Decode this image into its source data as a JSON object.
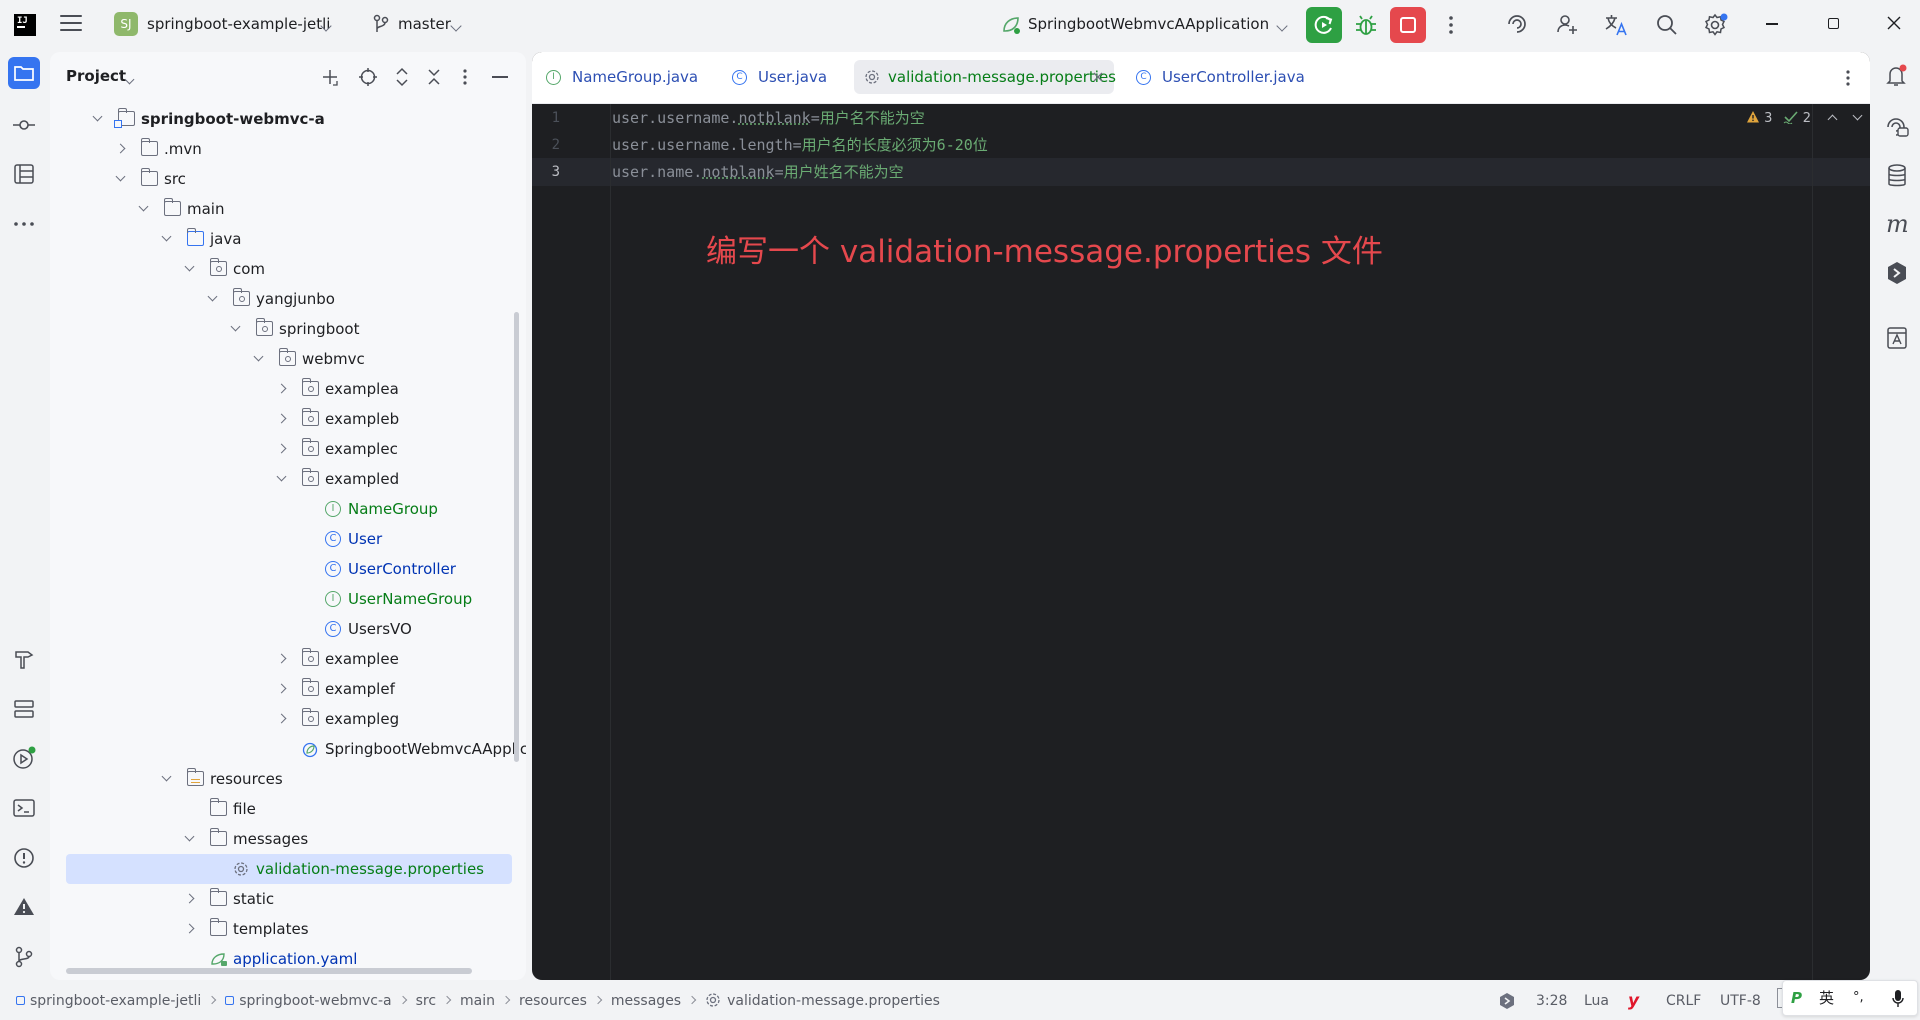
{
  "topbar": {
    "project_badge": "SJ",
    "project_name": "springboot-example-jetli",
    "branch": "master",
    "run_config": "SpringbootWebmvcAApplication"
  },
  "project_panel": {
    "title": "Project",
    "tree": [
      {
        "label": "springboot-webmvc-a",
        "bold": true
      },
      {
        "label": ".mvn"
      },
      {
        "label": "src"
      },
      {
        "label": "main"
      },
      {
        "label": "java"
      },
      {
        "label": "com"
      },
      {
        "label": "yangjunbo"
      },
      {
        "label": "springboot"
      },
      {
        "label": "webmvc"
      },
      {
        "label": "examplea"
      },
      {
        "label": "exampleb"
      },
      {
        "label": "examplec"
      },
      {
        "label": "exampled"
      },
      {
        "label": "NameGroup",
        "kind": "interface"
      },
      {
        "label": "User",
        "kind": "class"
      },
      {
        "label": "UserController",
        "kind": "class"
      },
      {
        "label": "UserNameGroup",
        "kind": "interface"
      },
      {
        "label": "UsersVO",
        "kind": "class"
      },
      {
        "label": "examplee"
      },
      {
        "label": "examplef"
      },
      {
        "label": "exampleg"
      },
      {
        "label": "SpringbootWebmvcAApplicat"
      },
      {
        "label": "resources"
      },
      {
        "label": "file"
      },
      {
        "label": "messages"
      },
      {
        "label": "validation-message.properties",
        "selected": true
      },
      {
        "label": "static"
      },
      {
        "label": "templates"
      },
      {
        "label": "application.yaml"
      }
    ],
    "icon_badges": {
      "interface": "I",
      "class": "C"
    }
  },
  "editor": {
    "tabs": [
      {
        "label": "NameGroup.java"
      },
      {
        "label": "User.java"
      },
      {
        "label": "validation-message.properties",
        "active": true
      },
      {
        "label": "UserController.java"
      }
    ],
    "lines": [
      {
        "num": "1",
        "key_a": "user.username.",
        "key_b": "notblank",
        "eq": "=",
        "value": "用户名不能为空"
      },
      {
        "num": "2",
        "key_a": "user.username.length",
        "key_b": "",
        "eq": "=",
        "value": "用户名的长度必须为6-20位"
      },
      {
        "num": "3",
        "key_a": "user.name.",
        "key_b": "notblank",
        "eq": "=",
        "value": "用户姓名不能为空"
      }
    ],
    "warnings": "3",
    "checks": "2",
    "annotation": "编写一个 validation-message.properties 文件"
  },
  "statusbar": {
    "crumbs": [
      "springboot-example-jetli",
      "springboot-webmvc-a",
      "src",
      "main",
      "resources",
      "messages",
      "validation-message.properties"
    ],
    "position": "3:28",
    "language": "Lua",
    "line_sep": "CRLF",
    "encoding": "UTF-8",
    "ime_lang": "英",
    "ime_punct": "°,"
  },
  "colors": {
    "accent": "#3574f0",
    "run_green": "#2ea043",
    "stop_red": "#e5484d",
    "annotation_red": "#e5484d"
  }
}
